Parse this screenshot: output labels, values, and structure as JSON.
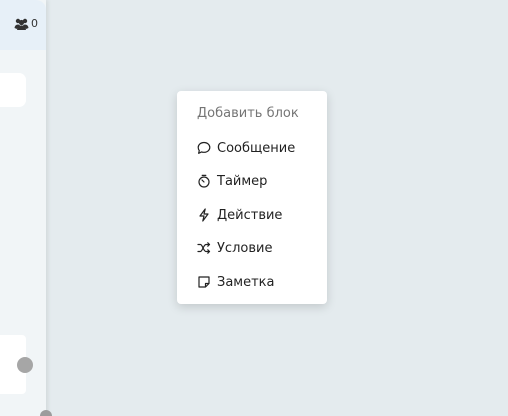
{
  "header": {
    "members_icon": "users-icon",
    "members_count": "0"
  },
  "menu": {
    "title": "Добавить блок",
    "items": [
      {
        "label": "Сообщение",
        "icon": "message-bubble-icon"
      },
      {
        "label": "Таймер",
        "icon": "timer-icon"
      },
      {
        "label": "Действие",
        "icon": "lightning-icon"
      },
      {
        "label": "Условие",
        "icon": "shuffle-icon"
      },
      {
        "label": "Заметка",
        "icon": "note-icon"
      }
    ]
  },
  "colors": {
    "canvas_bg": "#e4ebee",
    "panel_bg": "#f1f5f7",
    "header_bg": "#e7f0f8",
    "menu_bg": "#ffffff",
    "title_text": "#757575",
    "item_text": "#222222",
    "connector": "#a6a6a6"
  }
}
